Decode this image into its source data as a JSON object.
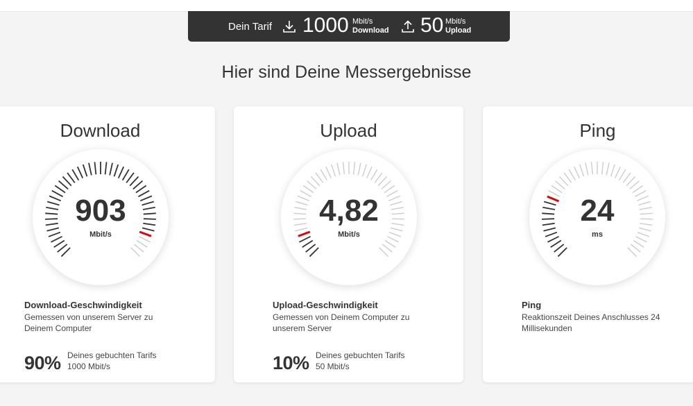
{
  "plan": {
    "label": "Dein Tarif",
    "download_value": "1000",
    "download_unit": "Mbit/s",
    "download_label": "Download",
    "upload_value": "50",
    "upload_unit": "Mbit/s",
    "upload_label": "Upload"
  },
  "heading": "Hier sind Deine Messergebnisse",
  "cards": [
    {
      "title": "Download",
      "value": "903",
      "unit": "Mbit/s",
      "fraction": 0.9,
      "info_title": "Download-Geschwindigkeit",
      "info_desc": "Gemessen von unserem Server zu Deinem Computer",
      "percent": "90%",
      "percent_line1": "Deines gebuchten Tarifs",
      "percent_line2": "1000 Mbit/s"
    },
    {
      "title": "Upload",
      "value": "4,82",
      "unit": "Mbit/s",
      "fraction": 0.1,
      "info_title": "Upload-Geschwindigkeit",
      "info_desc": "Gemessen von Deinem Computer zu unserem Server",
      "percent": "10%",
      "percent_line1": "Deines gebuchten Tarifs",
      "percent_line2": "50 Mbit/s"
    },
    {
      "title": "Ping",
      "value": "24",
      "unit": "ms",
      "fraction": 0.24,
      "info_title": "Ping",
      "info_desc": "Reaktionszeit Deines Anschlusses 24 Millisekunden"
    }
  ],
  "colors": {
    "accent": "#e60000",
    "tick_active": "#333333",
    "tick_inactive": "#cccccc",
    "plan_bar": "#333333"
  }
}
